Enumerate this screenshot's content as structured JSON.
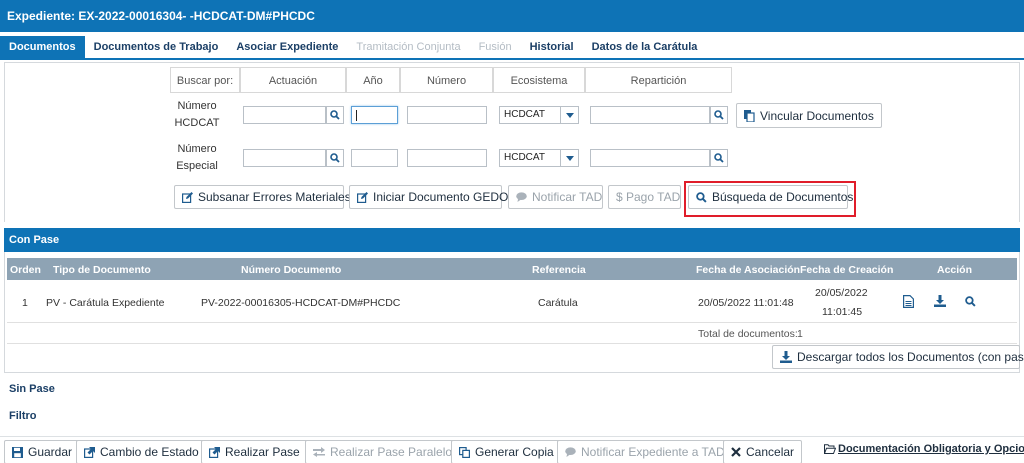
{
  "header": {
    "title": "Expediente: EX-2022-00016304- -HCDCAT-DM#PHCDC"
  },
  "tabs": [
    {
      "label": "Documentos",
      "state": "active"
    },
    {
      "label": "Documentos de Trabajo",
      "state": "enabled"
    },
    {
      "label": "Asociar Expediente",
      "state": "enabled"
    },
    {
      "label": "Tramitación Conjunta",
      "state": "disabled"
    },
    {
      "label": "Fusión",
      "state": "disabled"
    },
    {
      "label": "Historial",
      "state": "enabled"
    },
    {
      "label": "Datos de la Carátula",
      "state": "enabled"
    }
  ],
  "search": {
    "buscar_por": "Buscar por:",
    "col_actuacion": "Actuación",
    "col_anio": "Año",
    "col_numero": "Número",
    "col_ecosistema": "Ecosistema",
    "col_reparticion": "Repartición",
    "row1_label": "Número HCDCAT",
    "row2_label": "Número Especial",
    "row1_ecosistema": "HCDCAT",
    "row2_ecosistema": "HCDCAT",
    "vincular_label": "Vincular Documentos"
  },
  "actions": {
    "subsanar": "Subsanar Errores Materiales",
    "iniciar": "Iniciar Documento GEDO",
    "notificar_tad": "Notificar TAD",
    "pago_tad": "$ Pago TAD",
    "busqueda": "Búsqueda de Documentos"
  },
  "con_pase": {
    "section_title": "Con Pase",
    "columns": {
      "orden": "Orden",
      "tipo": "Tipo de Documento",
      "numero": "Número Documento",
      "referencia": "Referencia",
      "fecha_asoc": "Fecha de Asociación",
      "fecha_creacion": "Fecha de Creación",
      "accion": "Acción"
    },
    "rows": [
      {
        "orden": "1",
        "tipo": "PV - Carátula Expediente",
        "numero": "PV-2022-00016305-HCDCAT-DM#PHCDC",
        "referencia": "Carátula",
        "fecha_asoc": "20/05/2022 11:01:48",
        "fecha_creacion_fecha": "20/05/2022",
        "fecha_creacion_hora": "11:01:45"
      }
    ],
    "total_label": "Total de documentos:",
    "total_value": "1",
    "download_all": "Descargar todos los Documentos (con pase)"
  },
  "sin_pase": {
    "label": "Sin Pase"
  },
  "filtro": {
    "label": "Filtro"
  },
  "bottom": {
    "guardar": "Guardar",
    "cambio_estado": "Cambio de Estado",
    "realizar_pase": "Realizar Pase",
    "realizar_pase_paralelo": "Realizar Pase Paralelo",
    "generar_copia": "Generar Copia",
    "notificar_expediente": "Notificar Expediente a TAD",
    "cancelar": "Cancelar",
    "doc_obligatoria": "Documentación Obligatoria y Opcional"
  },
  "colors": {
    "primary": "#0e73b6",
    "table_header": "#8ea3b4",
    "highlight": "#e01d2a",
    "icon_blue": "#1f5c8f"
  }
}
